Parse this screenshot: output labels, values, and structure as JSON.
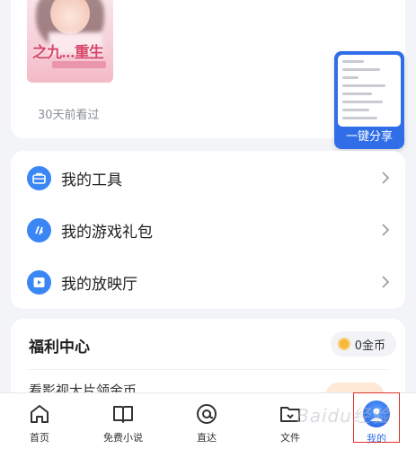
{
  "recent": {
    "cover_title": "之九...重生",
    "last_viewed": "30天前看过"
  },
  "share": {
    "label": "一键分享"
  },
  "menu": {
    "items": [
      {
        "label": "我的工具",
        "icon": "toolbox-icon"
      },
      {
        "label": "我的游戏礼包",
        "icon": "game-gift-icon"
      },
      {
        "label": "我的放映厅",
        "icon": "play-icon"
      }
    ]
  },
  "welfare": {
    "title": "福利中心",
    "coins": "0金币",
    "task_text": "看影视大片领金币"
  },
  "nav": {
    "items": [
      {
        "label": "首页",
        "icon": "home-icon"
      },
      {
        "label": "免费小说",
        "icon": "book-icon"
      },
      {
        "label": "直达",
        "icon": "at-icon"
      },
      {
        "label": "文件",
        "icon": "folder-icon"
      },
      {
        "label": "我的",
        "icon": "avatar-icon"
      }
    ]
  },
  "colors": {
    "accent": "#2f6ee8",
    "icon_blue": "#3a86f4",
    "highlight_red": "#e0302b",
    "background": "#f3f4f7"
  },
  "watermark": "Baidu经验"
}
